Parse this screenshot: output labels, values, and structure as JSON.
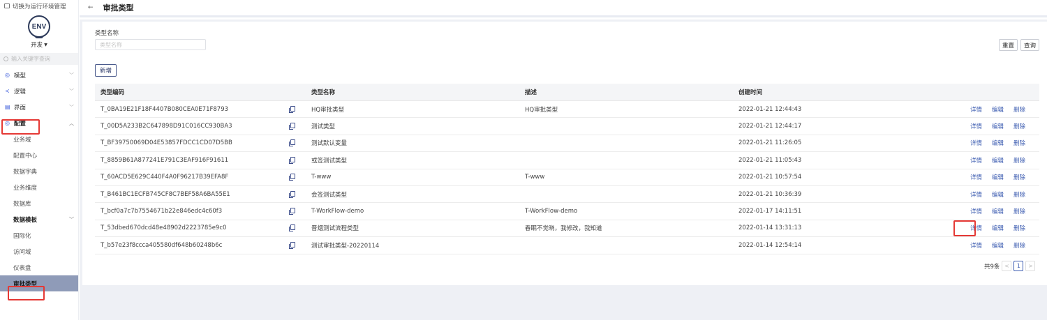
{
  "sidebar": {
    "switch_env": "切换为运行环境管理",
    "logo_text": "ENV",
    "env_select": "开发",
    "search_placeholder": "输入关键字查询",
    "items": [
      {
        "label": "模型",
        "icon": "◎",
        "chev": "﹀"
      },
      {
        "label": "逻辑",
        "icon": "≺",
        "chev": "﹀"
      },
      {
        "label": "界面",
        "icon": "▤",
        "chev": "﹀"
      },
      {
        "label": "配置",
        "icon": "◎",
        "chev": "︿"
      },
      {
        "label": "业务域"
      },
      {
        "label": "配置中心"
      },
      {
        "label": "数据字典"
      },
      {
        "label": "业务维度"
      },
      {
        "label": "数据库"
      },
      {
        "label": "数据模板",
        "chev": "﹀"
      },
      {
        "label": "国际化"
      },
      {
        "label": "访问域"
      },
      {
        "label": "仪表盘"
      },
      {
        "label": "审批类型"
      }
    ]
  },
  "header": {
    "back": "←",
    "title": "审批类型"
  },
  "filter": {
    "label": "类型名称",
    "placeholder": "类型名称",
    "reset": "重置",
    "query": "查询",
    "add": "新增"
  },
  "table": {
    "columns": [
      "类型编码",
      "类型名称",
      "描述",
      "创建时间"
    ],
    "ops": [
      "详情",
      "编辑",
      "删除"
    ],
    "rows": [
      {
        "code": "T_0BA19E21F18F4407B080CEA0E71F8793",
        "name": "HQ审批类型",
        "desc": "HQ审批类型",
        "time": "2022-01-21 12:44:43"
      },
      {
        "code": "T_00D5A233B2C647898D91C016CC930BA3",
        "name": "测试类型",
        "desc": "",
        "time": "2022-01-21 12:44:17"
      },
      {
        "code": "T_BF39750069D04E53857FDCC1CD07D5BB",
        "name": "测试默认变量",
        "desc": "",
        "time": "2022-01-21 11:26:05"
      },
      {
        "code": "T_8859B61A877241E791C3EAF916F91611",
        "name": "或签测试类型",
        "desc": "",
        "time": "2022-01-21 11:05:43"
      },
      {
        "code": "T_60ACD5E629C440F4A0F96217B39EFA8F",
        "name": "T-www",
        "desc": "T-www",
        "time": "2022-01-21 10:57:54"
      },
      {
        "code": "T_B461BC1ECFB745CF8C7BEF58A6BA55E1",
        "name": "会签测试类型",
        "desc": "",
        "time": "2022-01-21 10:36:39"
      },
      {
        "code": "T_bcf0a7c7b7554671b22e846edc4c60f3",
        "name": "T-WorkFlow-demo",
        "desc": "T-WorkFlow-demo",
        "time": "2022-01-17 14:11:51"
      },
      {
        "code": "T_53dbed670dcd48e48902d2223785e9c0",
        "name": "晋烟测试流程类型",
        "desc": "春眠不觉晓，我修改，我知道",
        "time": "2022-01-14 13:31:13"
      },
      {
        "code": "T_b57e23f8ccca405580df648b60248b6c",
        "name": "测试审批类型-20220114",
        "desc": "",
        "time": "2022-01-14 12:54:14"
      }
    ]
  },
  "pager": {
    "total": "共9条",
    "prev": "<",
    "current": "1",
    "next": ">"
  },
  "colors": {
    "accent": "#3b5bb0",
    "active_nav_bg": "#8f9bb8",
    "highlight": "#e53935"
  }
}
